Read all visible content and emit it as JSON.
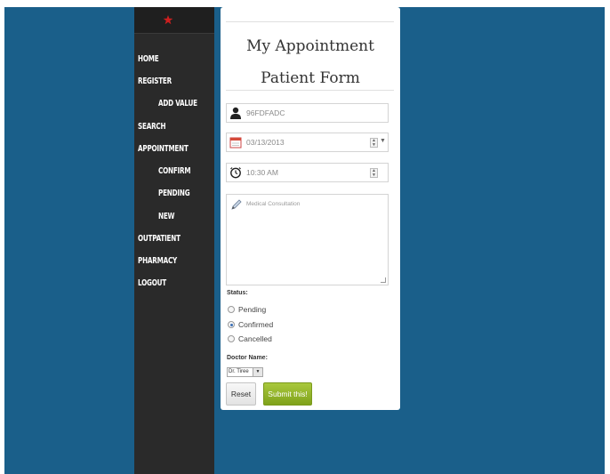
{
  "colors": {
    "background": "#1a5f8a",
    "sidebar": "#2a2a2a",
    "logo": "#cc1f1f",
    "submit": "#8cb127"
  },
  "sidebar": {
    "logo_icon": "crescent-star-icon",
    "items": [
      {
        "label": "HOME"
      },
      {
        "label": "REGISTER"
      },
      {
        "label": "ADD VALUE"
      },
      {
        "label": "SEARCH"
      },
      {
        "label": "APPOINTMENT"
      },
      {
        "label": "CONFIRM"
      },
      {
        "label": "PENDING"
      },
      {
        "label": "NEW"
      },
      {
        "label": "OUTPATIENT"
      },
      {
        "label": "PHARMACY"
      },
      {
        "label": "LOGOUT"
      }
    ]
  },
  "form": {
    "title": "My Appointment Patient Form",
    "patient_id": {
      "value": "96FDFADC",
      "icon": "user-icon"
    },
    "date": {
      "value": "03/13/2013",
      "icon": "calendar-icon"
    },
    "time": {
      "value": "10:30 AM",
      "icon": "clock-icon"
    },
    "notes": {
      "placeholder": "Medical Consultation",
      "icon": "pen-icon"
    },
    "status": {
      "label": "Status:",
      "options": [
        {
          "label": "Pending",
          "selected": false
        },
        {
          "label": "Confirmed",
          "selected": true
        },
        {
          "label": "Cancelled",
          "selected": false
        }
      ]
    },
    "doctor": {
      "label": "Doctor Name:",
      "selected": "Dr. Tiree"
    },
    "reset_label": "Reset",
    "submit_label": "Submit this!"
  }
}
